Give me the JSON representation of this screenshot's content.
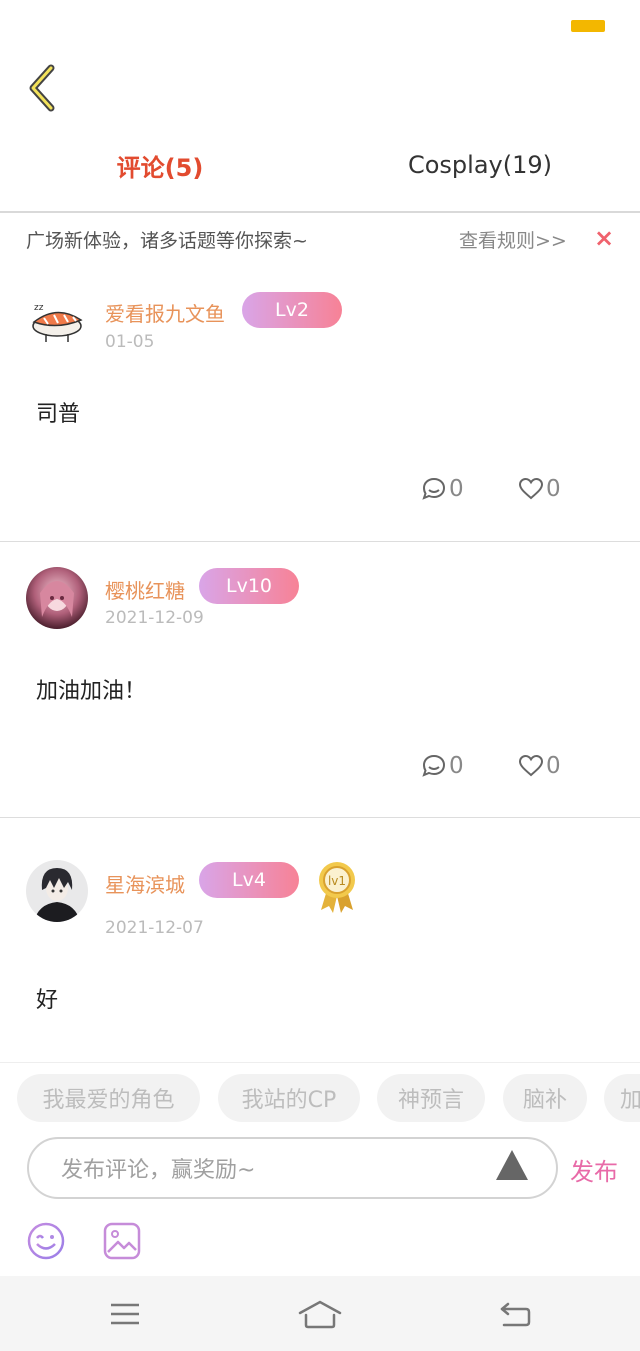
{
  "header": {
    "back_icon": "chevron-left-icon"
  },
  "tabs": [
    {
      "label": "评论(5)",
      "active": true
    },
    {
      "label": "Cosplay(19)",
      "active": false
    }
  ],
  "notice": {
    "text": "广场新体验，诸多话题等你探索~",
    "link": "查看规则>>",
    "close": "×"
  },
  "comments": [
    {
      "user": "爱看报九文鱼",
      "level": "Lv2",
      "date": "01-05",
      "text": "司普",
      "reply_count": "0",
      "like_count": "0"
    },
    {
      "user": "樱桃红糖",
      "level": "Lv10",
      "date": "2021-12-09",
      "text": "加油加油！",
      "reply_count": "0",
      "like_count": "0"
    },
    {
      "user": "星海滨城",
      "level": "Lv4",
      "date": "2021-12-07",
      "text": "好",
      "medal": "lv1"
    }
  ],
  "topics": [
    "我最爱的角色",
    "我站的CP",
    "神预言",
    "脑补",
    "加"
  ],
  "composer": {
    "placeholder": "发布评论，赢奖励~",
    "publish": "发布"
  },
  "colors": {
    "accent": "#e24b2f",
    "username": "#e8935a",
    "publish": "#e86aa8",
    "badge_start": "#d9a5e8",
    "badge_end": "#f78296"
  }
}
